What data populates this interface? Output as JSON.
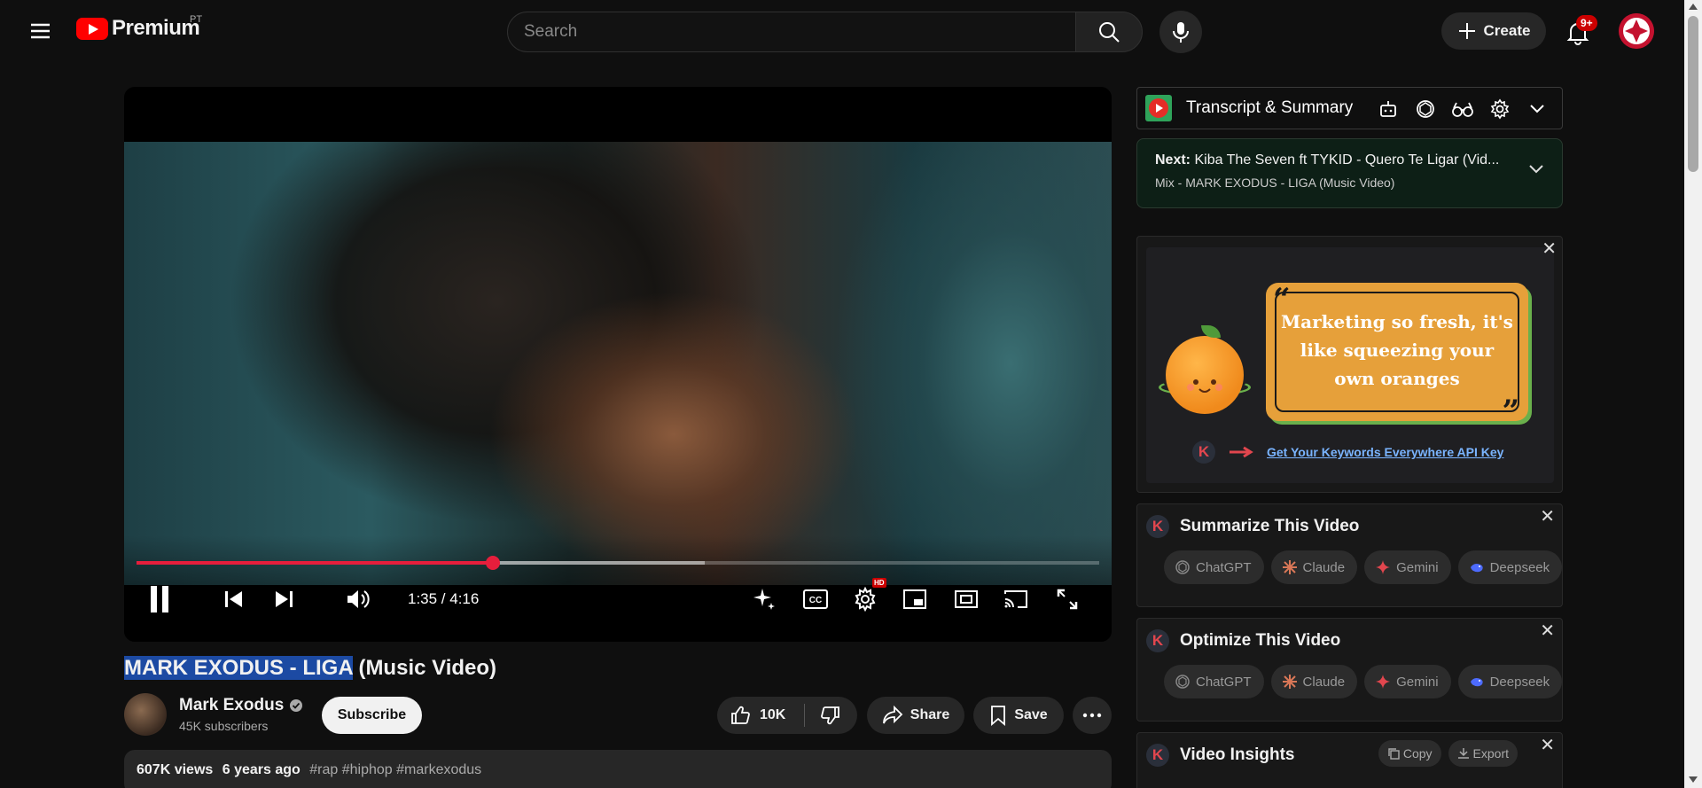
{
  "masthead": {
    "logo_text": "Premium",
    "country_code": "PT",
    "search_placeholder": "Search",
    "create_label": "Create",
    "notification_count": "9+"
  },
  "player": {
    "current_time": "1:35",
    "duration": "4:16",
    "time_display": "1:35 / 4:16",
    "progress_fraction": 0.37,
    "buffered_fraction": 0.59,
    "quality_badge": "HD",
    "state": "playing"
  },
  "video": {
    "title_highlighted": "MARK EXODUS - LIGA",
    "title_rest": " (Music Video)",
    "channel_name": "Mark Exodus",
    "subscribers": "45K subscribers",
    "subscribe_label": "Subscribe",
    "likes": "10K",
    "share_label": "Share",
    "save_label": "Save",
    "views": "607K views",
    "age": "6 years ago",
    "tags": "#rap #hiphop #markexodus"
  },
  "sidebar": {
    "transcript_title": "Transcript & Summary",
    "next_label": "Next:",
    "next_title": "Kiba The Seven ft TYKID - Quero Te Ligar (Vid...",
    "next_mix": "Mix - MARK EXODUS - LIGA (Music Video)",
    "ad": {
      "quote": "Marketing so fresh, it's like squeezing your own oranges",
      "cta": "Get Your Keywords Everywhere API Key"
    },
    "summarize_title": "Summarize This Video",
    "optimize_title": "Optimize This Video",
    "insights_title": "Video Insights",
    "ai_buttons": [
      "ChatGPT",
      "Claude",
      "Gemini",
      "Deepseek"
    ],
    "copy_label": "Copy",
    "export_label": "Export",
    "k_letter": "K"
  },
  "colors": {
    "accent_red": "#e61e3c",
    "youtube_red": "#ff0000",
    "link_blue": "#7ab4ff",
    "highlight_blue": "#1c4aa3"
  }
}
